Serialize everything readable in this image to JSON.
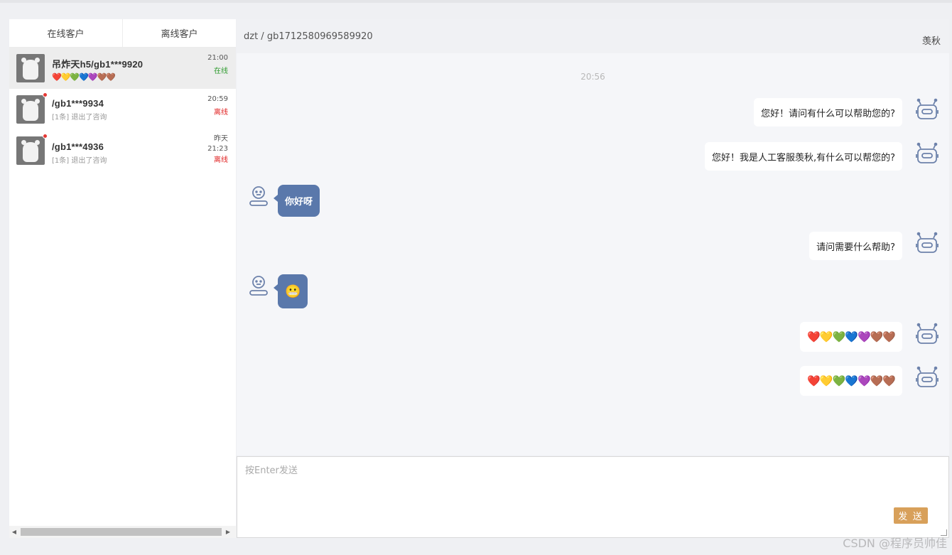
{
  "tabs": {
    "online": "在线客户",
    "offline": "离线客户"
  },
  "customers": [
    {
      "name": "吊炸天h5/gb1***9920",
      "hearts": "❤️💛💚💙💜🤎🤎",
      "time": "21:00",
      "time2": "",
      "status": "在线",
      "status_type": "on",
      "unread": false,
      "active": true
    },
    {
      "name": "/gb1***9934",
      "sub": "[1条] 退出了咨询",
      "time": "20:59",
      "time2": "",
      "status": "离线",
      "status_type": "off",
      "unread": true,
      "active": false
    },
    {
      "name": "/gb1***4936",
      "sub": "[1条] 退出了咨询",
      "time": "昨天",
      "time2": "21:23",
      "status": "离线",
      "status_type": "off",
      "unread": true,
      "active": false
    }
  ],
  "chat": {
    "title": "dzt / gb1712580969589920",
    "agent": "羡秋",
    "timestamp": "20:56",
    "messages": [
      {
        "from": "agent",
        "text": "您好！请问有什么可以帮助您的?"
      },
      {
        "from": "agent",
        "text": "您好！我是人工客服羡秋,有什么可以帮您的?"
      },
      {
        "from": "user",
        "text": "你好呀"
      },
      {
        "from": "agent",
        "text": "请问需要什么帮助?"
      },
      {
        "from": "user",
        "text": "😬"
      },
      {
        "from": "agent",
        "text": "❤️💛💚💙💜🤎🤎"
      },
      {
        "from": "agent",
        "text": "❤️💛💚💙💜🤎🤎"
      }
    ]
  },
  "input": {
    "placeholder": "按Enter发送",
    "send_label": "发 送"
  },
  "watermark": "CSDN @程序员帅佳",
  "icons": {
    "agent": "robot-icon",
    "user": "user-icon",
    "scroll_left": "arrow-left-icon",
    "scroll_right": "arrow-right-icon"
  },
  "colors": {
    "user_bubble": "#5a78ab",
    "send_button": "#d8a05a",
    "online": "#2e9b2e",
    "offline": "#e02020",
    "unread_dot": "#e53935"
  }
}
